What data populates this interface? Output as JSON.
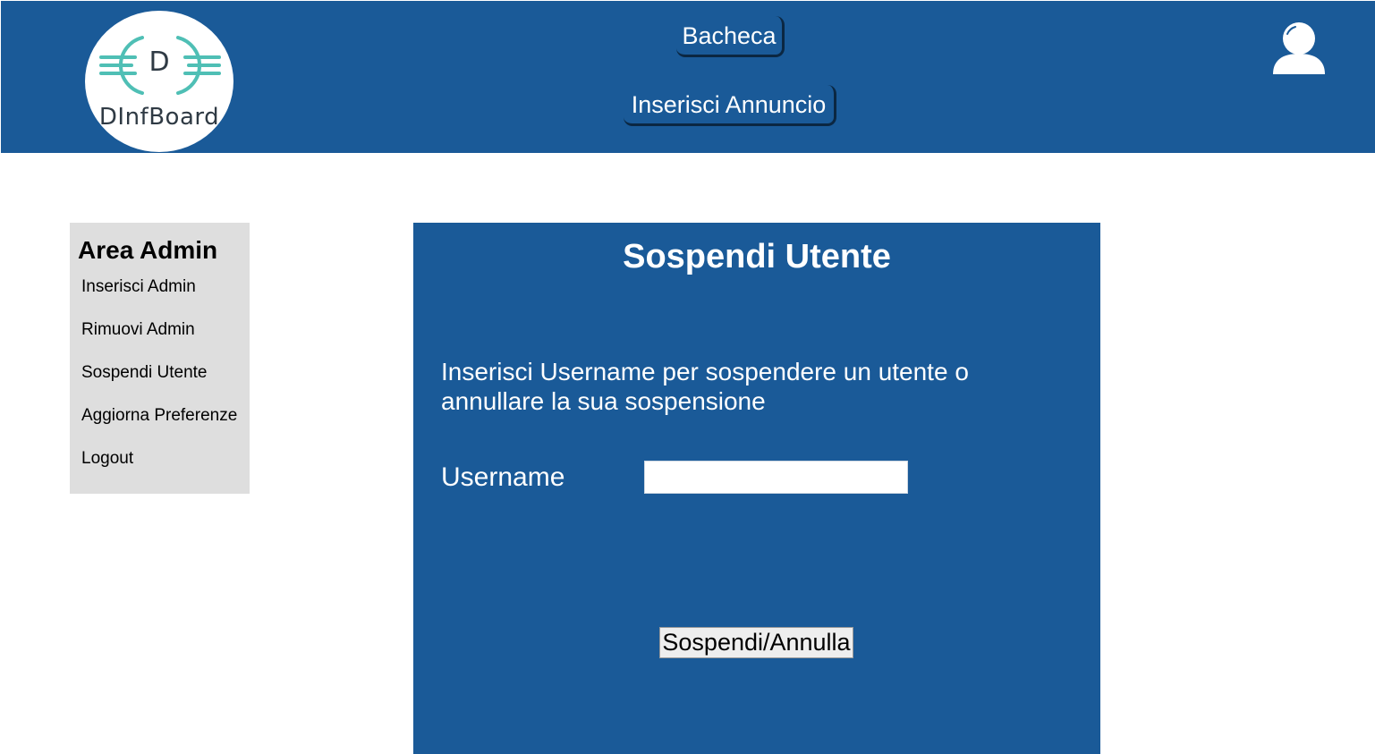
{
  "header": {
    "logo": {
      "letter": "D",
      "text": "DInfBoard",
      "accent_color": "#4fbfb5"
    },
    "nav": {
      "bacheca_label": "Bacheca",
      "inserisci_annuncio_label": "Inserisci Annuncio"
    },
    "user_icon": "user-profile-icon",
    "background_color": "#1a5a98"
  },
  "sidebar": {
    "title": "Area Admin",
    "items": [
      {
        "label": "Inserisci Admin"
      },
      {
        "label": "Rimuovi Admin"
      },
      {
        "label": "Sospendi Utente"
      },
      {
        "label": "Aggiorna Preferenze"
      },
      {
        "label": "Logout"
      }
    ],
    "background_color": "#dedede"
  },
  "main": {
    "title": "Sospendi Utente",
    "instructions": "Inserisci Username per sospendere un utente o annullare la sua sospensione",
    "username_label": "Username",
    "username_value": "",
    "submit_label": "Sospendi/Annulla",
    "background_color": "#1a5a98"
  }
}
